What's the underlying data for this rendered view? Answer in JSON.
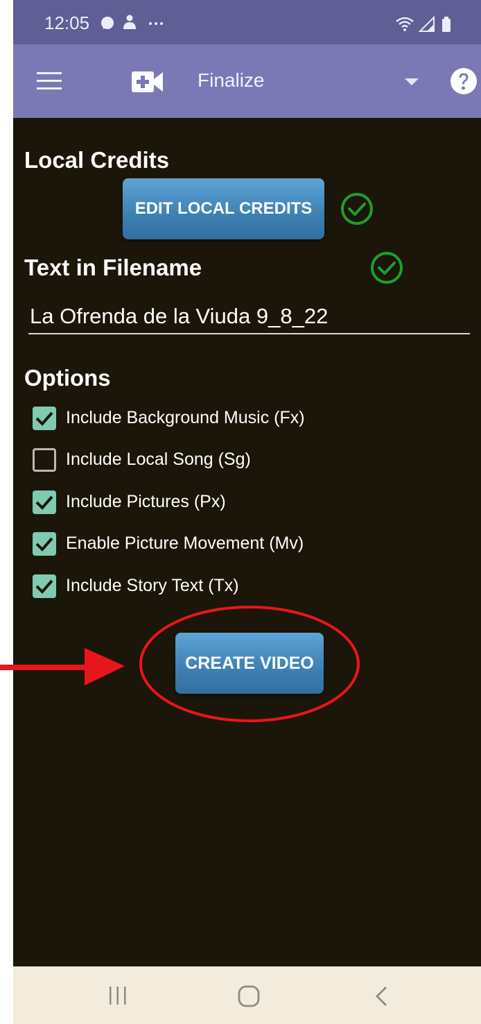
{
  "status_bar": {
    "time": "12:05",
    "left_icons": [
      "signal-messenger-icon",
      "accessibility-person-icon",
      "more-notifications-icon"
    ],
    "right_icons": [
      "wifi-icon",
      "cell-signal-icon",
      "battery-icon"
    ]
  },
  "app_bar": {
    "stage_title": "Finalize",
    "icons": [
      "menu-icon",
      "video-add-icon",
      "dropdown-icon",
      "help-icon"
    ]
  },
  "local_credits": {
    "heading": "Local Credits",
    "button_label": "EDIT LOCAL CREDITS",
    "status_icon": "check-circle-icon"
  },
  "filename": {
    "heading": "Text in Filename",
    "value": "La Ofrenda de la Viuda 9_8_22",
    "status_icon": "check-circle-icon"
  },
  "options": {
    "heading": "Options",
    "items": [
      {
        "label": "Include Background Music (Fx)",
        "checked": true
      },
      {
        "label": "Include Local Song (Sg)",
        "checked": false
      },
      {
        "label": "Include Pictures (Px)",
        "checked": true
      },
      {
        "label": "Enable Picture Movement (Mv)",
        "checked": true
      },
      {
        "label": "Include Story Text (Tx)",
        "checked": true
      }
    ]
  },
  "create_video": {
    "button_label": "CREATE VIDEO"
  },
  "nav_bar": {
    "icons": [
      "recents-icon",
      "home-icon",
      "back-icon"
    ]
  },
  "annotation": {
    "color": "#e8161a",
    "marks": [
      "red-arrow",
      "red-ellipse"
    ]
  },
  "colors": {
    "status_bar": "#5f5e95",
    "app_bar": "#7a79b5",
    "content_bg": "#1b1609",
    "button": "#4a8fc2",
    "check_green": "#1f9d2c",
    "checkbox_fill": "#7fcbb2",
    "nav_bar": "#f3ecdc"
  }
}
